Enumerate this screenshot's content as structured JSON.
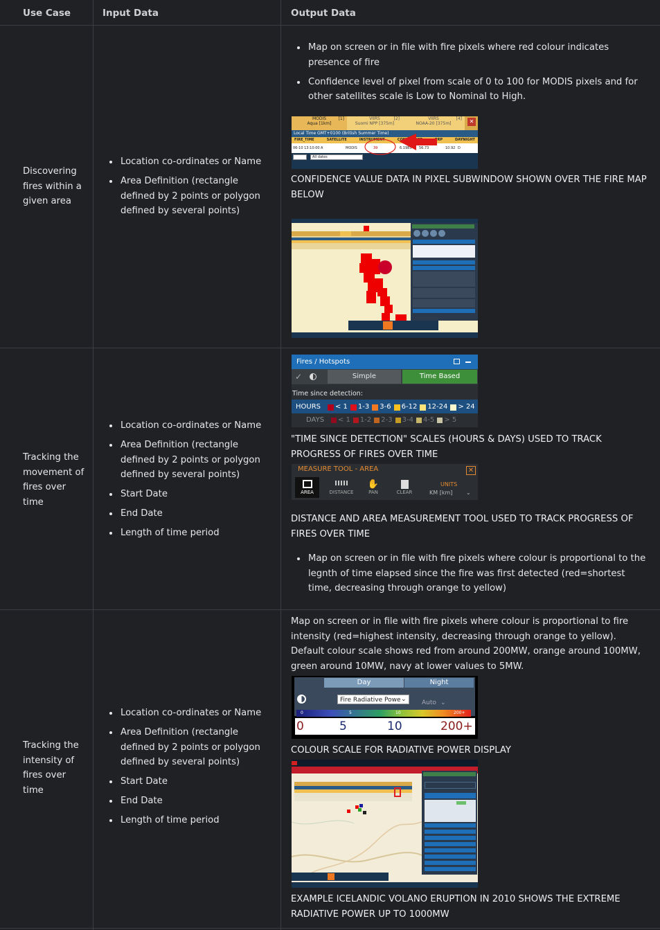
{
  "headers": {
    "use_case": "Use Case",
    "input": "Input Data",
    "output": "Output Data"
  },
  "rows": [
    {
      "use_case": "Discovering fires within a given area",
      "inputs": [
        "Location co-ordinates or Name",
        "Area Definition (rectangle defined by 2 points or polygon defined by several points)"
      ],
      "outputs": [
        "Map on screen or in file with fire pixels where red colour indicates presence of fire",
        "Confidence level of pixel from scale of 0 to 100 for MODIS pixels and for other satellites scale is Low to Nominal to High."
      ],
      "caption": "CONFIDENCE VALUE DATA IN PIXEL SUBWINDOW SHOWN OVER THE FIRE MAP BELOW",
      "conf_tabs": [
        {
          "name": "MODIS",
          "sub": "Aqua [1km]",
          "num": "[1]"
        },
        {
          "name": "VIIRS",
          "sub": "Suomi NPP [375m]",
          "num": "[2]"
        },
        {
          "name": "VIIRS",
          "sub": "NOAA-20 [375m]",
          "num": "[4]"
        }
      ],
      "conf_localtime": "Local Time GMT+0100 (British Summer Time)",
      "conf_cols": [
        "FIRE_TIME",
        "SATELLITE",
        "INSTRUMENT",
        "CONFIDENCE",
        "FRP",
        "DAYNIGHT"
      ],
      "conf_row": [
        "06-10 13:10:00",
        "A",
        "MODIS",
        "39",
        "6.1985",
        "56.73",
        "10.92",
        "D"
      ],
      "conf_select": "All dates",
      "close_glyph": "✕"
    },
    {
      "use_case": "Tracking the movement of fires over time",
      "inputs": [
        "Location co-ordinates or Name",
        "Area Definition (rectangle defined by 2 points or polygon defined by several points)",
        "Start Date",
        "End Date",
        "Length of time period"
      ],
      "fires_title": "Fires / Hotspots",
      "fires_tabs": [
        "Simple",
        "Time Based"
      ],
      "fires_since": "Time since detection:",
      "hours_label": "HOURS",
      "hours": [
        {
          "label": "< 1",
          "color": "#b3001a"
        },
        {
          "label": "1-3",
          "color": "#e0101a"
        },
        {
          "label": "3-6",
          "color": "#f07820"
        },
        {
          "label": "6-12",
          "color": "#f5c020"
        },
        {
          "label": "12-24",
          "color": "#fbe37a"
        },
        {
          "label": "> 24",
          "color": "#fff7cc"
        }
      ],
      "days_label": "DAYS",
      "days": [
        {
          "label": "< 1",
          "color": "#b3001a"
        },
        {
          "label": "1-2",
          "color": "#e0101a"
        },
        {
          "label": "2-3",
          "color": "#f07820"
        },
        {
          "label": "3-4",
          "color": "#f5c020"
        },
        {
          "label": "4-5",
          "color": "#fbe37a"
        },
        {
          "label": "> 5",
          "color": "#fff7cc"
        }
      ],
      "caption1": "\"TIME SINCE DETECTION\" SCALES (HOURS & DAYS) USED TO TRACK PROGRESS OF FIRES OVER TIME",
      "measure_title": "MEASURE TOOL - AREA",
      "measure_tools": [
        "AREA",
        "DISTANCE",
        "PAN",
        "CLEAR"
      ],
      "measure_units_label": "UNITS",
      "measure_units_value": "KM [km]",
      "caption2": "DISTANCE AND AREA MEASUREMENT TOOL USED TO TRACK PROGRESS OF FIRES OVER TIME",
      "outputs": [
        "Map on screen or in file with fire pixels where colour is proportional to the legnth of time elapsed since the fire was first detected (red=shortest time, decreasing through orange to yellow)"
      ]
    },
    {
      "use_case": "Tracking the intensity of fires over time",
      "inputs": [
        "Location co-ordinates or Name",
        "Area Definition (rectangle defined by 2 points or polygon defined by several points)",
        "Start Date",
        "End Date",
        "Length of time period"
      ],
      "output_text": "Map on screen or in file with fire pixels where colour is proportional to fire intensity (red=highest intensity, decreasing through orange to yellow). Default colour scale shows red from around 200MW, orange around 100MW, green around 10MW, navy at lower values to 5MW.",
      "frp_tabs": [
        "Day",
        "Night"
      ],
      "frp_select": "Fire Radiative Powe",
      "frp_auto": "Auto",
      "frp_small": [
        "0",
        "5",
        "10",
        "200+"
      ],
      "frp_big": [
        "0",
        "5",
        "10",
        "200+"
      ],
      "caption1": "COLOUR SCALE FOR RADIATIVE POWER DISPLAY",
      "caption2": "EXAMPLE ICELANDIC VOLANO ERUPTION IN 2010 SHOWS THE EXTREME RADIATIVE POWER UP TO 1000MW"
    }
  ]
}
